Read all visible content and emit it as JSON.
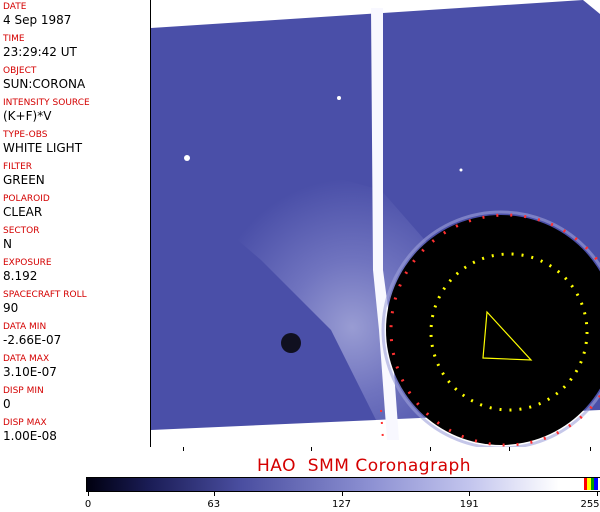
{
  "header_fields": [
    {
      "label": "DATE",
      "value": "4 Sep 1987"
    },
    {
      "label": "TIME",
      "value": "23:29:42 UT"
    },
    {
      "label": "OBJECT",
      "value": "SUN:CORONA"
    },
    {
      "label": "INTENSITY SOURCE",
      "value": "(K+F)*V"
    },
    {
      "label": "TYPE-OBS",
      "value": "WHITE LIGHT"
    },
    {
      "label": "FILTER",
      "value": "GREEN"
    },
    {
      "label": "POLAROID",
      "value": "CLEAR"
    },
    {
      "label": "SECTOR",
      "value": "N"
    },
    {
      "label": "EXPOSURE",
      "value": "8.192"
    },
    {
      "label": "SPACECRAFT ROLL",
      "value": "90"
    },
    {
      "label": "DATA MIN",
      "value": "-2.66E-07"
    },
    {
      "label": "DATA MAX",
      "value": "3.10E-07"
    },
    {
      "label": "DISP MIN",
      "value": "0"
    },
    {
      "label": "DISP MAX",
      "value": "1.00E-08"
    }
  ],
  "instrument_title": "HAO  SMM Coronagraph",
  "colorbar": {
    "ticks": [
      "0",
      "63",
      "127",
      "191",
      "255"
    ],
    "min": 0,
    "max": 255
  },
  "colors": {
    "label_red": "#d40000",
    "image_blue": "#4a4fa8",
    "occulter": "#000000"
  }
}
